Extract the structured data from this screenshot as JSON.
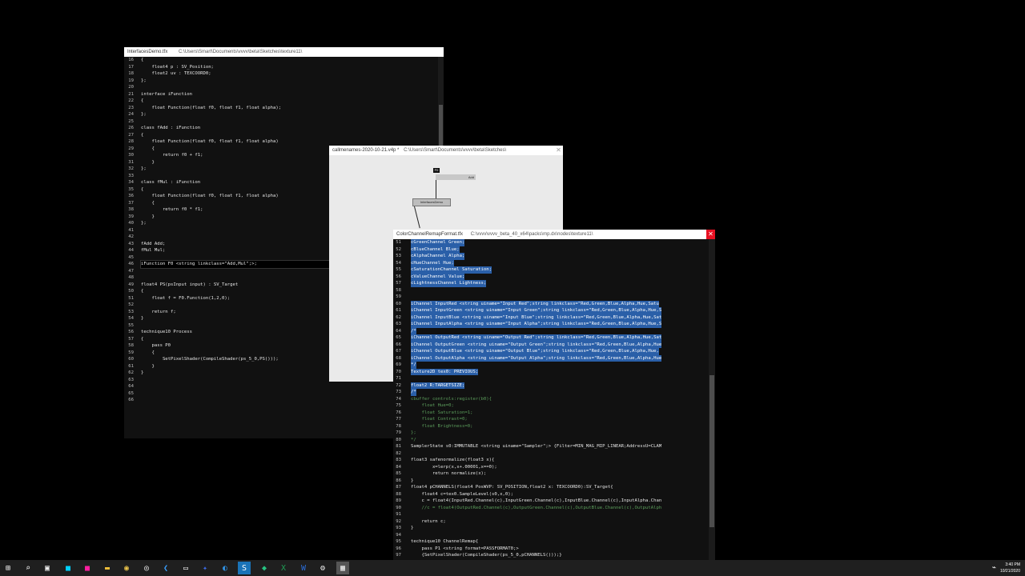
{
  "win1": {
    "title": "InterfacesDemo.tfx",
    "path": "C:\\Users\\Smart\\Documents\\vvvv\\beta\\Sketches\\texture11\\",
    "lines": [
      {
        "n": "16",
        "t": "{"
      },
      {
        "n": "17",
        "t": "    float4 p : SV_Position;"
      },
      {
        "n": "18",
        "t": "    float2 uv : TEXCOORD0;"
      },
      {
        "n": "19",
        "t": "};"
      },
      {
        "n": "20",
        "t": ""
      },
      {
        "n": "21",
        "t": "interface iFunction"
      },
      {
        "n": "22",
        "t": "{"
      },
      {
        "n": "23",
        "t": "    float Function(float f0, float f1, float alpha);"
      },
      {
        "n": "24",
        "t": "};"
      },
      {
        "n": "25",
        "t": ""
      },
      {
        "n": "26",
        "t": "class fAdd : iFunction"
      },
      {
        "n": "27",
        "t": "{"
      },
      {
        "n": "28",
        "t": "    float Function(float f0, float f1, float alpha)"
      },
      {
        "n": "29",
        "t": "    {"
      },
      {
        "n": "30",
        "t": "        return f0 + f1;"
      },
      {
        "n": "31",
        "t": "    }"
      },
      {
        "n": "32",
        "t": "};"
      },
      {
        "n": "33",
        "t": ""
      },
      {
        "n": "34",
        "t": "class fMul : iFunction"
      },
      {
        "n": "35",
        "t": "{"
      },
      {
        "n": "36",
        "t": "    float Function(float f0, float f1, float alpha)"
      },
      {
        "n": "37",
        "t": "    {"
      },
      {
        "n": "38",
        "t": "        return f0 * f1;"
      },
      {
        "n": "39",
        "t": "    }"
      },
      {
        "n": "40",
        "t": "};"
      },
      {
        "n": "41",
        "t": ""
      },
      {
        "n": "42",
        "t": ""
      },
      {
        "n": "43",
        "t": "fAdd Add;"
      },
      {
        "n": "44",
        "t": "fMul Mul;"
      },
      {
        "n": "45",
        "t": ""
      },
      {
        "n": "46",
        "t": "iFunction F0 <string linkclass=\"Add,Mul\";>;"
      },
      {
        "n": "47",
        "t": ""
      },
      {
        "n": "48",
        "t": ""
      },
      {
        "n": "49",
        "t": "float4 PS(psInput input) : SV_Target"
      },
      {
        "n": "50",
        "t": "{"
      },
      {
        "n": "51",
        "t": "    float f = F0.Function(1,2,0);"
      },
      {
        "n": "52",
        "t": ""
      },
      {
        "n": "53",
        "t": "    return f;"
      },
      {
        "n": "54",
        "t": "}"
      },
      {
        "n": "55",
        "t": ""
      },
      {
        "n": "56",
        "t": "technique10 Process"
      },
      {
        "n": "57",
        "t": "{"
      },
      {
        "n": "58",
        "t": "    pass P0"
      },
      {
        "n": "59",
        "t": "    {"
      },
      {
        "n": "60",
        "t": "        SetPixelShader(CompileShader(ps_5_0,PS()));"
      },
      {
        "n": "61",
        "t": "    }"
      },
      {
        "n": "62",
        "t": "}"
      },
      {
        "n": "63",
        "t": ""
      },
      {
        "n": "64",
        "t": ""
      },
      {
        "n": "65",
        "t": ""
      },
      {
        "n": "66",
        "t": ""
      }
    ]
  },
  "win2": {
    "title": "callmenames-2020-10-21.v4p *",
    "path": "C:\\Users\\Smart\\Documents\\vvvv\\beta\\Sketches\\",
    "node_f0": "F0",
    "node_add": "Add",
    "node_demo": "InterfacesDemo"
  },
  "win3": {
    "title": "ColorChannelRemapFormat.tfx",
    "path": "C:\\vvvv\\vvvv_beta_40_x64\\packs\\mp.dx\\nodes\\texture11\\",
    "close_glyph": "✕",
    "lines": [
      {
        "n": "51",
        "t": "cGreenChannel Green;",
        "h": true
      },
      {
        "n": "52",
        "t": "cBlueChannel Blue;",
        "h": true
      },
      {
        "n": "53",
        "t": "cAlphaChannel Alpha;",
        "h": true
      },
      {
        "n": "54",
        "t": "cHueChannel Hue;",
        "h": true
      },
      {
        "n": "55",
        "t": "cSaturationChannel Saturation;",
        "h": true
      },
      {
        "n": "56",
        "t": "cValueChannel Value;",
        "h": true
      },
      {
        "n": "57",
        "t": "cLightnessChannel Lightness;",
        "h": true
      },
      {
        "n": "58",
        "t": "",
        "h": true
      },
      {
        "n": "59",
        "t": "",
        "h": true
      },
      {
        "n": "60",
        "t": "iChannel InputRed <string uiname=\"Input Red\";string linkclass=\"Red,Green,Blue,Alpha,Hue,Satu",
        "h": true
      },
      {
        "n": "61",
        "t": "iChannel InputGreen <string uiname=\"Input Green\";string linkclass=\"Red,Green,Blue,Alpha,Hue,S",
        "h": true
      },
      {
        "n": "62",
        "t": "iChannel InputBlue <string uiname=\"Input Blue\";string linkclass=\"Red,Green,Blue,Alpha,Hue,Sat",
        "h": true
      },
      {
        "n": "63",
        "t": "iChannel InputAlpha <string uiname=\"Input Alpha\";string linkclass=\"Red,Green,Blue,Alpha,Hue,S",
        "h": true
      },
      {
        "n": "64",
        "t": "/*",
        "h": true
      },
      {
        "n": "65",
        "t": "iChannel OutputRed <string uiname=\"Output Red\";string linkclass=\"Red,Green,Blue,Alpha,Hue,Sat",
        "h": true
      },
      {
        "n": "66",
        "t": "iChannel OutputGreen <string uiname=\"Output Green\";string linkclass=\"Red,Green,Blue,Alpha,Hue",
        "h": true
      },
      {
        "n": "67",
        "t": "iChannel OutputBlue <string uiname=\"Output Blue\";string linkclass=\"Red,Green,Blue,Alpha,Hue,",
        "h": true
      },
      {
        "n": "68",
        "t": "iChannel OutputAlpha <string uiname=\"Output Alpha\";string linkclass=\"Red,Green,Blue,Alpha,Hue",
        "h": true
      },
      {
        "n": "69",
        "t": "*/",
        "h": true
      },
      {
        "n": "70",
        "t": "Texture2D tex0: PREVIOUS;",
        "h": true
      },
      {
        "n": "71",
        "t": "",
        "h": false
      },
      {
        "n": "72",
        "t": "float2 R:TARGETSIZE;",
        "h": true
      },
      {
        "n": "73",
        "t": "/*",
        "h": true
      },
      {
        "n": "74",
        "t": "cbuffer controls:register(b0){",
        "h": false,
        "c": true
      },
      {
        "n": "75",
        "t": "    float Hue=0;",
        "h": false,
        "c": true
      },
      {
        "n": "76",
        "t": "    float Saturation=1;",
        "h": false,
        "c": true
      },
      {
        "n": "77",
        "t": "    float Contrast=0;",
        "h": false,
        "c": true
      },
      {
        "n": "78",
        "t": "    float Brightness=0;",
        "h": false,
        "c": true
      },
      {
        "n": "79",
        "t": "};",
        "h": false,
        "c": true
      },
      {
        "n": "80",
        "t": "*/",
        "h": false,
        "c": true
      },
      {
        "n": "81",
        "t": "SamplerState s0:IMMUTABLE <string uiname=\"Sampler\";> {Filter=MIN_MAG_MIP_LINEAR;AddressU=CLAM",
        "h": false
      },
      {
        "n": "82",
        "t": "",
        "h": false
      },
      {
        "n": "83",
        "t": "float3 safenormalize(float3 x){",
        "h": false
      },
      {
        "n": "84",
        "t": "        x=lerp(x,x+.00001,x==0);",
        "h": false
      },
      {
        "n": "85",
        "t": "        return normalize(x);",
        "h": false
      },
      {
        "n": "86",
        "t": "}",
        "h": false
      },
      {
        "n": "87",
        "t": "float4 pCHANNELS(float4 PosWVP: SV_POSITION,float2 x: TEXCOORD0):SV_Target{",
        "h": false
      },
      {
        "n": "88",
        "t": "    float4 c=tex0.SampleLevel(s0,x,0);",
        "h": false
      },
      {
        "n": "89",
        "t": "    c = float4(InputRed.Channel(c),InputGreen.Channel(c),InputBlue.Channel(c),InputAlpha.Chan",
        "h": false
      },
      {
        "n": "90",
        "t": "    //c = float4(OutputRed.Channel(c),OutputGreen.Channel(c),OutputBlue.Channel(c),OutputAlph",
        "h": false,
        "c": true
      },
      {
        "n": "91",
        "t": "",
        "h": false
      },
      {
        "n": "92",
        "t": "    return c;",
        "h": false
      },
      {
        "n": "93",
        "t": "}",
        "h": false
      },
      {
        "n": "94",
        "t": "",
        "h": false
      },
      {
        "n": "95",
        "t": "technique10 ChannelRemap{",
        "h": false
      },
      {
        "n": "96",
        "t": "    pass P1 <string format=PASSFORMAT0;>",
        "h": false
      },
      {
        "n": "97",
        "t": "    {SetPixelShader(CompileShader(ps_5_0,pCHANNELS()));}",
        "h": false
      }
    ]
  },
  "taskbar": {
    "time": "3:40 PM",
    "date": "10/21/2020",
    "icons": [
      "windows-start-icon",
      "search-icon",
      "task-view-icon",
      "app-cyan-icon",
      "app-magenta-icon",
      "file-explorer-icon",
      "chrome-icon",
      "app-circle-icon",
      "vscode-icon",
      "app-window-icon",
      "app-blue-icon",
      "edge-icon",
      "app-s-icon",
      "app-green-icon",
      "excel-icon",
      "word-icon",
      "app-gear-icon",
      "vvvv-icon"
    ]
  }
}
